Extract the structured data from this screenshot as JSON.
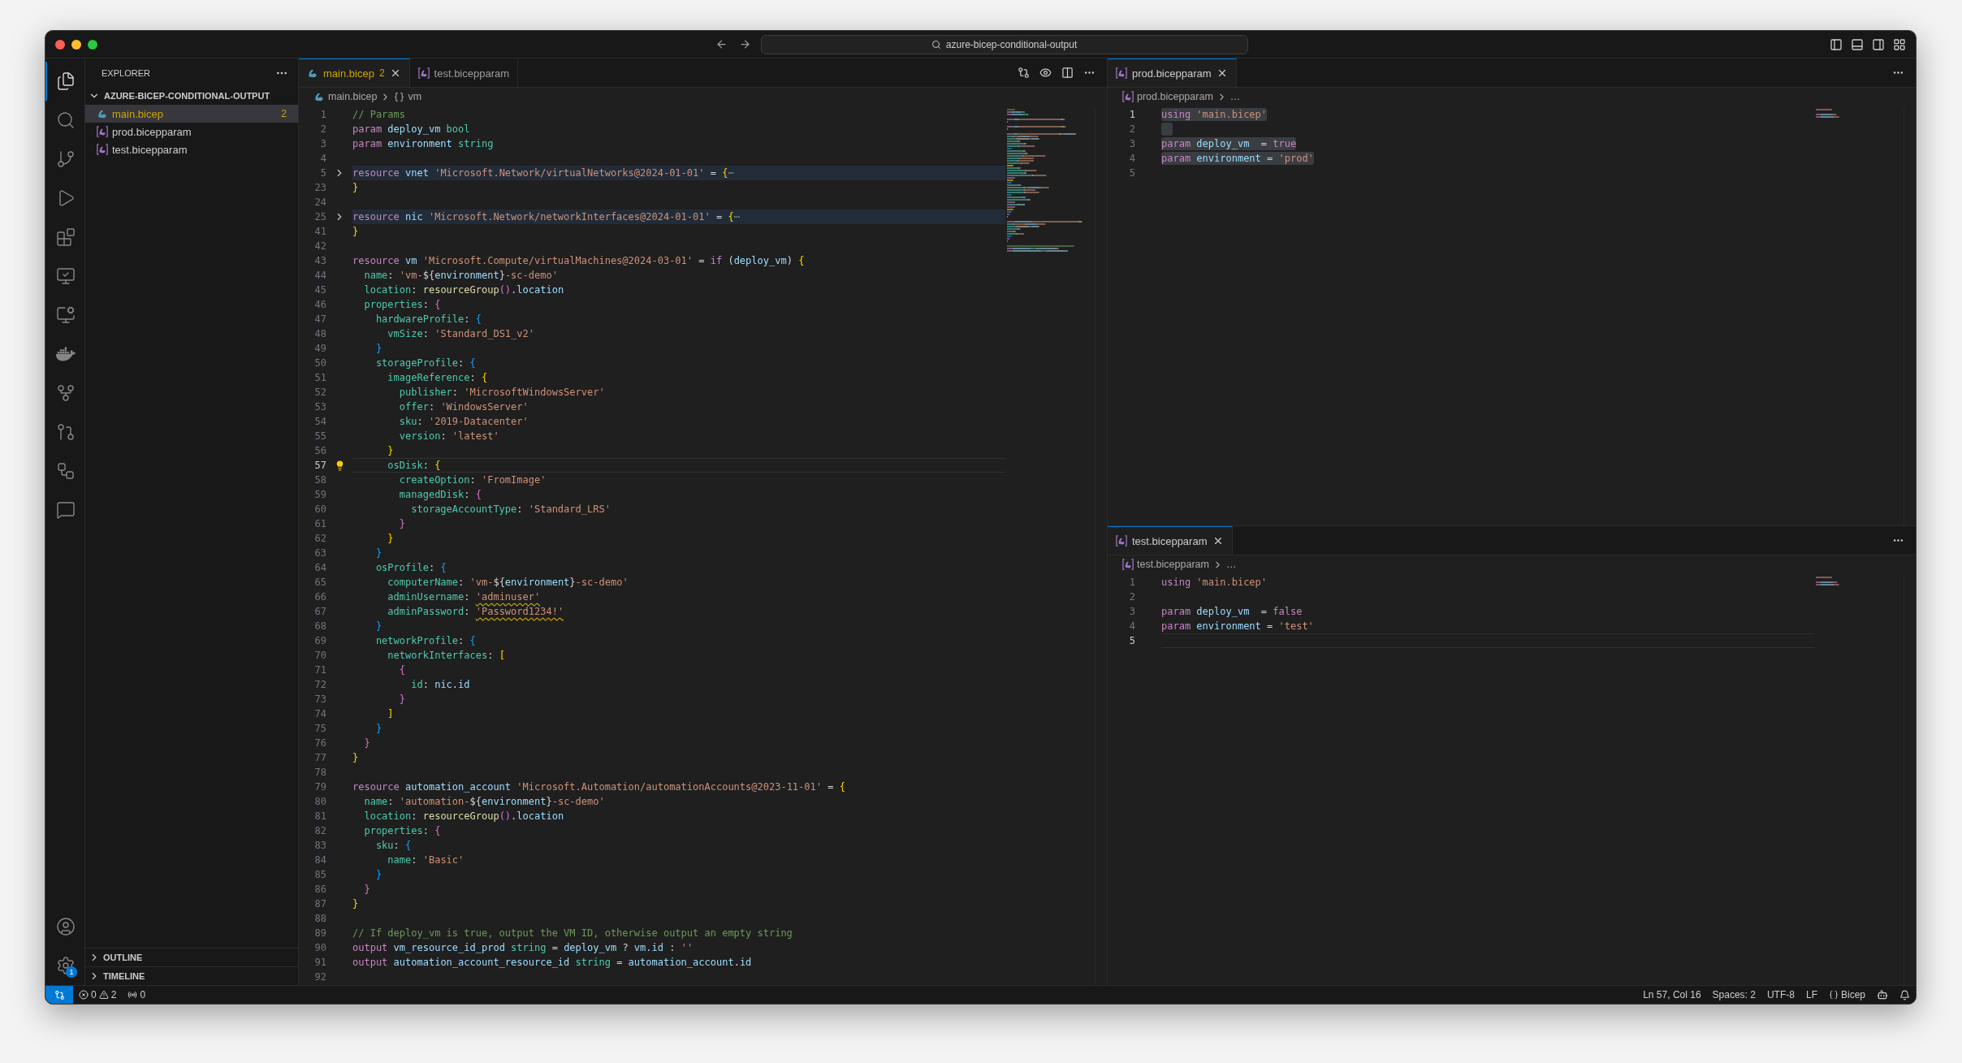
{
  "window": {
    "search": "azure-bicep-conditional-output"
  },
  "activity_bar": {
    "items": [
      {
        "selected": true
      },
      {
        "selected": false
      },
      {
        "selected": false
      },
      {
        "selected": false
      },
      {
        "selected": false
      },
      {
        "selected": false
      },
      {
        "selected": false
      },
      {
        "selected": false
      },
      {
        "selected": false
      },
      {
        "selected": false
      },
      {
        "selected": false
      },
      {
        "selected": false
      }
    ],
    "settings_badge": "1"
  },
  "sidebar": {
    "title": "EXPLORER",
    "folder": {
      "name": "AZURE-BICEP-CONDITIONAL-OUTPUT",
      "expanded": true,
      "children": [
        {
          "name": "main.bicep",
          "kind": "bicep",
          "selected": true,
          "warning": true,
          "badge": "2"
        },
        {
          "name": "prod.bicepparam",
          "kind": "bicepparam",
          "selected": false,
          "warning": false
        },
        {
          "name": "test.bicepparam",
          "kind": "bicepparam",
          "selected": false,
          "warning": false
        }
      ]
    },
    "sections": [
      {
        "name": "OUTLINE",
        "expanded": false
      },
      {
        "name": "TIMELINE",
        "expanded": false
      }
    ]
  },
  "editors": [
    {
      "tabs": [
        {
          "label": "main.bicep",
          "kind": "bicep",
          "selected": true,
          "warning": true,
          "badge": "2"
        },
        {
          "label": "test.bicepparam",
          "kind": "bicepparam",
          "selected": false,
          "warning": false
        }
      ],
      "breadcrumb": {
        "file": "main.bicep",
        "kind": "bicep",
        "symbol": "vm"
      },
      "lightbulb": true,
      "lines": [
        {
          "n": "1",
          "kind": "code",
          "tokens": [
            {
              "text": "// Params",
              "kind": "cm"
            }
          ]
        },
        {
          "n": "2",
          "kind": "code",
          "tokens": [
            {
              "text": "param",
              "kind": "kw"
            },
            {
              "text": " deploy_vm ",
              "kind": "id"
            },
            {
              "text": "bool",
              "kind": "type"
            }
          ]
        },
        {
          "n": "3",
          "kind": "code",
          "tokens": [
            {
              "text": "param",
              "kind": "kw"
            },
            {
              "text": " environment ",
              "kind": "id"
            },
            {
              "text": "string",
              "kind": "type"
            }
          ]
        },
        {
          "n": "4",
          "kind": "code"
        },
        {
          "n": "5",
          "kind": "folded",
          "tokens": [
            {
              "text": "resource",
              "kind": "kw"
            },
            {
              "text": " vnet ",
              "kind": "id"
            },
            {
              "text": "'Microsoft.Network/virtualNetworks@2024-01-01'",
              "kind": "str"
            },
            {
              "text": " = ",
              "kind": "p"
            },
            {
              "text": "{",
              "kind": "b1"
            },
            {
              "text": "⋯",
              "kind": "ell"
            }
          ]
        },
        {
          "n": "23",
          "kind": "code",
          "tokens": [
            {
              "text": "}",
              "kind": "b1"
            }
          ]
        },
        {
          "n": "24",
          "kind": "code"
        },
        {
          "n": "25",
          "kind": "folded",
          "tokens": [
            {
              "text": "resource",
              "kind": "kw"
            },
            {
              "text": " nic ",
              "kind": "id"
            },
            {
              "text": "'Microsoft.Network/networkInterfaces@2024-01-01'",
              "kind": "str"
            },
            {
              "text": " = ",
              "kind": "p"
            },
            {
              "text": "{",
              "kind": "b1"
            },
            {
              "text": "⋯",
              "kind": "ell"
            }
          ]
        },
        {
          "n": "41",
          "kind": "code",
          "tokens": [
            {
              "text": "}",
              "kind": "b1"
            }
          ]
        },
        {
          "n": "42",
          "kind": "code"
        },
        {
          "n": "43",
          "kind": "code",
          "tokens": [
            {
              "text": "resource",
              "kind": "kw"
            },
            {
              "text": " vm ",
              "kind": "id"
            },
            {
              "text": "'Microsoft.Compute/virtualMachines@2024-03-01'",
              "kind": "str"
            },
            {
              "text": " = ",
              "kind": "p"
            },
            {
              "text": "if",
              "kind": "kw"
            },
            {
              "text": " (",
              "kind": "p"
            },
            {
              "text": "deploy_vm",
              "kind": "id"
            },
            {
              "text": ") ",
              "kind": "p"
            },
            {
              "text": "{",
              "kind": "b1"
            }
          ]
        },
        {
          "n": "44",
          "kind": "code",
          "tokens": [
            {
              "text": "  name",
              "kind": "prop"
            },
            {
              "text": ": ",
              "kind": "p"
            },
            {
              "text": "'vm-",
              "kind": "str"
            },
            {
              "text": "${",
              "kind": "p"
            },
            {
              "text": "environment",
              "kind": "id"
            },
            {
              "text": "}",
              "kind": "p"
            },
            {
              "text": "-sc-demo'",
              "kind": "str"
            }
          ]
        },
        {
          "n": "45",
          "kind": "code",
          "tokens": [
            {
              "text": "  location",
              "kind": "prop"
            },
            {
              "text": ": ",
              "kind": "p"
            },
            {
              "text": "resourceGroup",
              "kind": "fn"
            },
            {
              "text": "()",
              "kind": "b2"
            },
            {
              "text": ".",
              "kind": "p"
            },
            {
              "text": "location",
              "kind": "id"
            }
          ]
        },
        {
          "n": "46",
          "kind": "code",
          "tokens": [
            {
              "text": "  properties",
              "kind": "prop"
            },
            {
              "text": ": ",
              "kind": "p"
            },
            {
              "text": "{",
              "kind": "b2"
            }
          ]
        },
        {
          "n": "47",
          "kind": "code",
          "tokens": [
            {
              "text": "    hardwareProfile",
              "kind": "prop"
            },
            {
              "text": ": ",
              "kind": "p"
            },
            {
              "text": "{",
              "kind": "b3"
            }
          ]
        },
        {
          "n": "48",
          "kind": "code",
          "tokens": [
            {
              "text": "      vmSize",
              "kind": "prop"
            },
            {
              "text": ": ",
              "kind": "p"
            },
            {
              "text": "'Standard_DS1_v2'",
              "kind": "str"
            }
          ]
        },
        {
          "n": "49",
          "kind": "code",
          "tokens": [
            {
              "text": "    }",
              "kind": "b3"
            }
          ]
        },
        {
          "n": "50",
          "kind": "code",
          "tokens": [
            {
              "text": "    storageProfile",
              "kind": "prop"
            },
            {
              "text": ": ",
              "kind": "p"
            },
            {
              "text": "{",
              "kind": "b3"
            }
          ]
        },
        {
          "n": "51",
          "kind": "code",
          "tokens": [
            {
              "text": "      imageReference",
              "kind": "prop"
            },
            {
              "text": ": ",
              "kind": "p"
            },
            {
              "text": "{",
              "kind": "b1"
            }
          ]
        },
        {
          "n": "52",
          "kind": "code",
          "tokens": [
            {
              "text": "        publisher",
              "kind": "prop"
            },
            {
              "text": ": ",
              "kind": "p"
            },
            {
              "text": "'MicrosoftWindowsServer'",
              "kind": "str"
            }
          ]
        },
        {
          "n": "53",
          "kind": "code",
          "tokens": [
            {
              "text": "        offer",
              "kind": "prop"
            },
            {
              "text": ": ",
              "kind": "p"
            },
            {
              "text": "'WindowsServer'",
              "kind": "str"
            }
          ]
        },
        {
          "n": "54",
          "kind": "code",
          "tokens": [
            {
              "text": "        sku",
              "kind": "prop"
            },
            {
              "text": ": ",
              "kind": "p"
            },
            {
              "text": "'2019-Datacenter'",
              "kind": "str"
            }
          ]
        },
        {
          "n": "55",
          "kind": "code",
          "tokens": [
            {
              "text": "        version",
              "kind": "prop"
            },
            {
              "text": ": ",
              "kind": "p"
            },
            {
              "text": "'latest'",
              "kind": "str"
            }
          ]
        },
        {
          "n": "56",
          "kind": "code",
          "tokens": [
            {
              "text": "      }",
              "kind": "b1"
            }
          ]
        },
        {
          "n": "57",
          "kind": "current",
          "tokens": [
            {
              "text": "      osDisk",
              "kind": "prop"
            },
            {
              "text": ": ",
              "kind": "p"
            },
            {
              "text": "{",
              "kind": "b1"
            }
          ]
        },
        {
          "n": "58",
          "kind": "code",
          "tokens": [
            {
              "text": "        createOption",
              "kind": "prop"
            },
            {
              "text": ": ",
              "kind": "p"
            },
            {
              "text": "'FromImage'",
              "kind": "str"
            }
          ]
        },
        {
          "n": "59",
          "kind": "code",
          "tokens": [
            {
              "text": "        managedDisk",
              "kind": "prop"
            },
            {
              "text": ": ",
              "kind": "p"
            },
            {
              "text": "{",
              "kind": "b2"
            }
          ]
        },
        {
          "n": "60",
          "kind": "code",
          "tokens": [
            {
              "text": "          storageAccountType",
              "kind": "prop"
            },
            {
              "text": ": ",
              "kind": "p"
            },
            {
              "text": "'Standard_LRS'",
              "kind": "str"
            }
          ]
        },
        {
          "n": "61",
          "kind": "code",
          "tokens": [
            {
              "text": "        }",
              "kind": "b2"
            }
          ]
        },
        {
          "n": "62",
          "kind": "code",
          "tokens": [
            {
              "text": "      }",
              "kind": "b1"
            }
          ]
        },
        {
          "n": "63",
          "kind": "code",
          "tokens": [
            {
              "text": "    }",
              "kind": "b3"
            }
          ]
        },
        {
          "n": "64",
          "kind": "code",
          "tokens": [
            {
              "text": "    osProfile",
              "kind": "prop"
            },
            {
              "text": ": ",
              "kind": "p"
            },
            {
              "text": "{",
              "kind": "b3"
            }
          ]
        },
        {
          "n": "65",
          "kind": "code",
          "tokens": [
            {
              "text": "      computerName",
              "kind": "prop"
            },
            {
              "text": ": ",
              "kind": "p"
            },
            {
              "text": "'vm-",
              "kind": "str"
            },
            {
              "text": "${",
              "kind": "p"
            },
            {
              "text": "environment",
              "kind": "id"
            },
            {
              "text": "}",
              "kind": "p"
            },
            {
              "text": "-sc-demo'",
              "kind": "str"
            }
          ]
        },
        {
          "n": "66",
          "kind": "code",
          "tokens": [
            {
              "text": "      adminUsername",
              "kind": "prop"
            },
            {
              "text": ": ",
              "kind": "p"
            },
            {
              "text": "'adminuser'",
              "kind": "warn"
            }
          ]
        },
        {
          "n": "67",
          "kind": "code",
          "tokens": [
            {
              "text": "      adminPassword",
              "kind": "prop"
            },
            {
              "text": ": ",
              "kind": "p"
            },
            {
              "text": "'Password1234!'",
              "kind": "warn"
            }
          ]
        },
        {
          "n": "68",
          "kind": "code",
          "tokens": [
            {
              "text": "    }",
              "kind": "b3"
            }
          ]
        },
        {
          "n": "69",
          "kind": "code",
          "tokens": [
            {
              "text": "    networkProfile",
              "kind": "prop"
            },
            {
              "text": ": ",
              "kind": "p"
            },
            {
              "text": "{",
              "kind": "b3"
            }
          ]
        },
        {
          "n": "70",
          "kind": "code",
          "tokens": [
            {
              "text": "      networkInterfaces",
              "kind": "prop"
            },
            {
              "text": ": ",
              "kind": "p"
            },
            {
              "text": "[",
              "kind": "b1"
            }
          ]
        },
        {
          "n": "71",
          "kind": "code",
          "tokens": [
            {
              "text": "        {",
              "kind": "b2"
            }
          ]
        },
        {
          "n": "72",
          "kind": "code",
          "tokens": [
            {
              "text": "          id",
              "kind": "prop"
            },
            {
              "text": ": ",
              "kind": "p"
            },
            {
              "text": "nic",
              "kind": "id"
            },
            {
              "text": ".",
              "kind": "p"
            },
            {
              "text": "id",
              "kind": "id"
            }
          ]
        },
        {
          "n": "73",
          "kind": "code",
          "tokens": [
            {
              "text": "        }",
              "kind": "b2"
            }
          ]
        },
        {
          "n": "74",
          "kind": "code",
          "tokens": [
            {
              "text": "      ]",
              "kind": "b1"
            }
          ]
        },
        {
          "n": "75",
          "kind": "code",
          "tokens": [
            {
              "text": "    }",
              "kind": "b3"
            }
          ]
        },
        {
          "n": "76",
          "kind": "code",
          "tokens": [
            {
              "text": "  }",
              "kind": "b2"
            }
          ]
        },
        {
          "n": "77",
          "kind": "code",
          "tokens": [
            {
              "text": "}",
              "kind": "b1"
            }
          ]
        },
        {
          "n": "78",
          "kind": "code"
        },
        {
          "n": "79",
          "kind": "code",
          "tokens": [
            {
              "text": "resource",
              "kind": "kw"
            },
            {
              "text": " automation_account ",
              "kind": "id"
            },
            {
              "text": "'Microsoft.Automation/automationAccounts@2023-11-01'",
              "kind": "str"
            },
            {
              "text": " = ",
              "kind": "p"
            },
            {
              "text": "{",
              "kind": "b1"
            }
          ]
        },
        {
          "n": "80",
          "kind": "code",
          "tokens": [
            {
              "text": "  name",
              "kind": "prop"
            },
            {
              "text": ": ",
              "kind": "p"
            },
            {
              "text": "'automation-",
              "kind": "str"
            },
            {
              "text": "${",
              "kind": "p"
            },
            {
              "text": "environment",
              "kind": "id"
            },
            {
              "text": "}",
              "kind": "p"
            },
            {
              "text": "-sc-demo'",
              "kind": "str"
            }
          ]
        },
        {
          "n": "81",
          "kind": "code",
          "tokens": [
            {
              "text": "  location",
              "kind": "prop"
            },
            {
              "text": ": ",
              "kind": "p"
            },
            {
              "text": "resourceGroup",
              "kind": "fn"
            },
            {
              "text": "()",
              "kind": "b2"
            },
            {
              "text": ".",
              "kind": "p"
            },
            {
              "text": "location",
              "kind": "id"
            }
          ]
        },
        {
          "n": "82",
          "kind": "code",
          "tokens": [
            {
              "text": "  properties",
              "kind": "prop"
            },
            {
              "text": ": ",
              "kind": "p"
            },
            {
              "text": "{",
              "kind": "b2"
            }
          ]
        },
        {
          "n": "83",
          "kind": "code",
          "tokens": [
            {
              "text": "    sku",
              "kind": "prop"
            },
            {
              "text": ": ",
              "kind": "p"
            },
            {
              "text": "{",
              "kind": "b3"
            }
          ]
        },
        {
          "n": "84",
          "kind": "code",
          "tokens": [
            {
              "text": "      name",
              "kind": "prop"
            },
            {
              "text": ": ",
              "kind": "p"
            },
            {
              "text": "'Basic'",
              "kind": "str"
            }
          ]
        },
        {
          "n": "85",
          "kind": "code",
          "tokens": [
            {
              "text": "    }",
              "kind": "b3"
            }
          ]
        },
        {
          "n": "86",
          "kind": "code",
          "tokens": [
            {
              "text": "  }",
              "kind": "b2"
            }
          ]
        },
        {
          "n": "87",
          "kind": "code",
          "tokens": [
            {
              "text": "}",
              "kind": "b1"
            }
          ]
        },
        {
          "n": "88",
          "kind": "code"
        },
        {
          "n": "89",
          "kind": "code",
          "tokens": [
            {
              "text": "// If deploy_vm is true, output the VM ID, otherwise output an empty string",
              "kind": "cm"
            }
          ]
        },
        {
          "n": "90",
          "kind": "code",
          "tokens": [
            {
              "text": "output",
              "kind": "kw"
            },
            {
              "text": " vm_resource_id_prod ",
              "kind": "id"
            },
            {
              "text": "string",
              "kind": "type"
            },
            {
              "text": " = ",
              "kind": "p"
            },
            {
              "text": "deploy_vm",
              "kind": "id"
            },
            {
              "text": " ? ",
              "kind": "p"
            },
            {
              "text": "vm",
              "kind": "id"
            },
            {
              "text": ".",
              "kind": "p"
            },
            {
              "text": "id",
              "kind": "id"
            },
            {
              "text": " : ",
              "kind": "p"
            },
            {
              "text": "''",
              "kind": "str"
            }
          ]
        },
        {
          "n": "91",
          "kind": "code",
          "tokens": [
            {
              "text": "output",
              "kind": "kw"
            },
            {
              "text": " automation_account_resource_id ",
              "kind": "id"
            },
            {
              "text": "string",
              "kind": "type"
            },
            {
              "text": " = ",
              "kind": "p"
            },
            {
              "text": "automation_account",
              "kind": "id"
            },
            {
              "text": ".",
              "kind": "p"
            },
            {
              "text": "id",
              "kind": "id"
            }
          ]
        },
        {
          "n": "92",
          "kind": "code"
        }
      ]
    },
    {
      "tabs": [
        {
          "label": "prod.bicepparam",
          "kind": "bicepparam",
          "selected": true,
          "warning": false
        }
      ],
      "breadcrumb": {
        "file": "prod.bicepparam",
        "kind": "bicepparam",
        "more": "…"
      },
      "lines": [
        {
          "n": "1",
          "kind": "selected-current",
          "tokens": [
            {
              "text": "using",
              "kind": "kw"
            },
            {
              "text": " 'main.bicep'",
              "kind": "str"
            }
          ]
        },
        {
          "n": "2",
          "kind": "selected"
        },
        {
          "n": "3",
          "kind": "selected",
          "tokens": [
            {
              "text": "param",
              "kind": "kw"
            },
            {
              "text": " deploy_vm  ",
              "kind": "id"
            },
            {
              "text": "= ",
              "kind": "p"
            },
            {
              "text": "true",
              "kind": "kw"
            }
          ]
        },
        {
          "n": "4",
          "kind": "selected",
          "tokens": [
            {
              "text": "param",
              "kind": "kw"
            },
            {
              "text": " environment ",
              "kind": "id"
            },
            {
              "text": "= ",
              "kind": "p"
            },
            {
              "text": "'prod'",
              "kind": "str"
            }
          ]
        },
        {
          "n": "5",
          "kind": "code"
        }
      ]
    },
    {
      "tabs": [
        {
          "label": "test.bicepparam",
          "kind": "bicepparam",
          "selected": true,
          "warning": false
        }
      ],
      "breadcrumb": {
        "file": "test.bicepparam",
        "kind": "bicepparam",
        "more": "…"
      },
      "lines": [
        {
          "n": "1",
          "kind": "code",
          "tokens": [
            {
              "text": "using",
              "kind": "kw"
            },
            {
              "text": " 'main.bicep'",
              "kind": "str"
            }
          ]
        },
        {
          "n": "2",
          "kind": "code"
        },
        {
          "n": "3",
          "kind": "code",
          "tokens": [
            {
              "text": "param",
              "kind": "kw"
            },
            {
              "text": " deploy_vm  ",
              "kind": "id"
            },
            {
              "text": "= ",
              "kind": "p"
            },
            {
              "text": "false",
              "kind": "kw"
            }
          ]
        },
        {
          "n": "4",
          "kind": "code",
          "tokens": [
            {
              "text": "param",
              "kind": "kw"
            },
            {
              "text": " environment ",
              "kind": "id"
            },
            {
              "text": "= ",
              "kind": "p"
            },
            {
              "text": "'test'",
              "kind": "str"
            }
          ]
        },
        {
          "n": "5",
          "kind": "current"
        }
      ]
    }
  ],
  "status_bar": {
    "errors": "0",
    "warnings": "2",
    "ports": "0",
    "position": "Ln 57, Col 16",
    "indent": "Spaces: 2",
    "encoding": "UTF-8",
    "eol": "LF",
    "language": "Bicep"
  }
}
